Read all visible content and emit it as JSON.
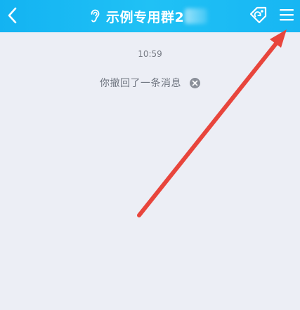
{
  "header": {
    "title": "示例专用群2",
    "back_icon": "chevron-left-icon",
    "ear_icon": "earpiece-icon",
    "tag_icon": "tag-refresh-icon",
    "menu_icon": "hamburger-menu-icon",
    "background": "#1ab9f4"
  },
  "chat": {
    "timestamp": "10:59",
    "recall_notice": "你撤回了一条消息"
  },
  "annotation": {
    "arrow_color": "#e8453c"
  }
}
